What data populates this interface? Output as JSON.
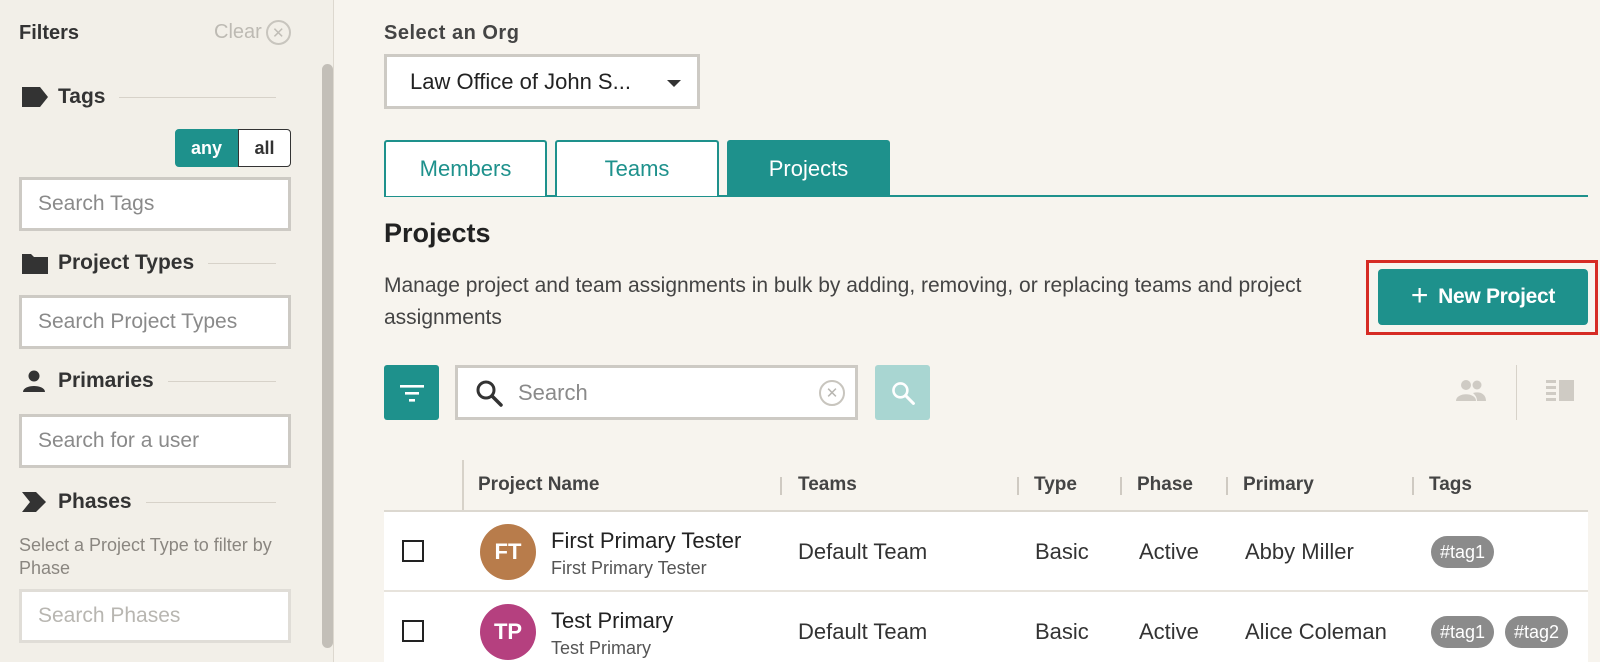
{
  "sidebar": {
    "title": "Filters",
    "clear_label": "Clear",
    "tags": {
      "label": "Tags",
      "toggle_any": "any",
      "toggle_all": "all",
      "toggle_selected": "any",
      "search_placeholder": "Search Tags"
    },
    "project_types": {
      "label": "Project Types",
      "search_placeholder": "Search Project Types"
    },
    "primaries": {
      "label": "Primaries",
      "search_placeholder": "Search for a user"
    },
    "phases": {
      "label": "Phases",
      "help": "Select a Project Type to filter by Phase",
      "search_placeholder": "Search Phases"
    }
  },
  "org": {
    "label": "Select an Org",
    "selected": "Law Office of John S..."
  },
  "tabs": [
    {
      "label": "Members",
      "active": false
    },
    {
      "label": "Teams",
      "active": false
    },
    {
      "label": "Projects",
      "active": true
    }
  ],
  "main": {
    "heading": "Projects",
    "description": "Manage project and team assignments in bulk by adding, removing, or replacing teams and project assignments",
    "new_project_label": "New Project",
    "search_placeholder": "Search"
  },
  "table": {
    "columns": [
      "Project Name",
      "Teams",
      "Type",
      "Phase",
      "Primary",
      "Tags"
    ],
    "rows": [
      {
        "initials": "FT",
        "avatar_color": "#b87c4b",
        "name": "First Primary Tester",
        "subtitle": "First Primary Tester",
        "team": "Default Team",
        "type": "Basic",
        "phase": "Active",
        "primary": "Abby Miller",
        "tags": [
          "#tag1"
        ]
      },
      {
        "initials": "TP",
        "avatar_color": "#b5407f",
        "name": "Test Primary",
        "subtitle": "Test Primary",
        "team": "Default Team",
        "type": "Basic",
        "phase": "Active",
        "primary": "Alice Coleman",
        "tags": [
          "#tag1",
          "#tag2"
        ]
      }
    ]
  },
  "colors": {
    "accent": "#1e918c",
    "accent_disabled": "#a9d6d2",
    "highlight_frame": "#d62b24",
    "tag_bg": "#8b8b8b"
  }
}
